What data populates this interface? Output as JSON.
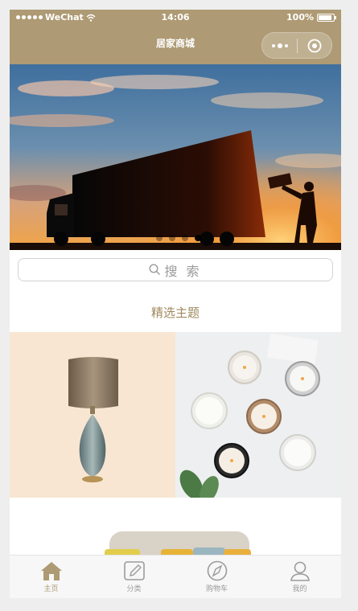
{
  "status_bar": {
    "carrier": "WeChat",
    "time": "14:06",
    "battery": "100%",
    "battery_level": 1.0
  },
  "navbar": {
    "title": "居家商城"
  },
  "banner": {
    "slide_count": 4,
    "active_index": 3
  },
  "search": {
    "placeholder": "搜 索"
  },
  "section": {
    "title": "精选主题"
  },
  "tabbar": {
    "items": [
      {
        "label": "主页",
        "icon": "home-icon",
        "active": true
      },
      {
        "label": "分类",
        "icon": "edit-icon",
        "active": false
      },
      {
        "label": "购物车",
        "icon": "compass-icon",
        "active": false
      },
      {
        "label": "我的",
        "icon": "user-icon",
        "active": false
      }
    ]
  },
  "colors": {
    "brand": "#ae9a74",
    "accent_text": "#a08a5e",
    "tab_inactive": "#9b9b9b"
  }
}
